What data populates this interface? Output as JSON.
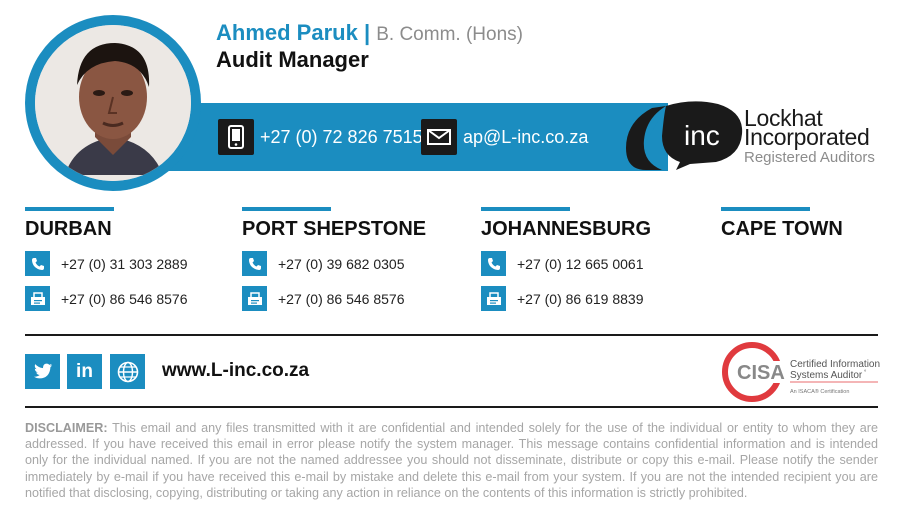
{
  "person": {
    "name": "Ahmed Paruk",
    "separator": "|",
    "qualification": "B. Comm. (Hons)",
    "role": "Audit Manager"
  },
  "contact": {
    "phone": "+27 (0) 72 826 7515",
    "email": "ap@L-inc.co.za",
    "phone_icon": "mobile-phone-icon",
    "email_icon": "envelope-icon"
  },
  "logo": {
    "mark": "inc",
    "line1": "Lockhat",
    "line2": "Incorporated",
    "line3": "Registered Auditors"
  },
  "offices": [
    {
      "city": "DURBAN",
      "phone": "+27 (0) 31 303 2889",
      "fax": "+27 (0) 86 546 8576"
    },
    {
      "city": "PORT SHEPSTONE",
      "phone": "+27 (0) 39 682 0305",
      "fax": "+27 (0) 86 546 8576"
    },
    {
      "city": "JOHANNESBURG",
      "phone": "+27 (0) 12 665 0061",
      "fax": "+27 (0) 86 619 8839"
    },
    {
      "city": "CAPE TOWN"
    }
  ],
  "social": {
    "twitter": "twitter-icon",
    "linkedin_label": "in",
    "web_icon": "globe-icon",
    "website": "www.L-inc.co.za"
  },
  "cisa": {
    "badge": "CISA",
    "line1": "Certified Information",
    "line2": "Systems Auditor",
    "mark": "°",
    "sub": "An ISACA® Certification"
  },
  "disclaimer": {
    "label": "DISCLAIMER:",
    "text": " This email and any files transmitted with it are confidential and intended solely for the use of the individual or entity to whom they are addressed. If you have received this email in error please notify the system manager. This message contains confidential information and is intended only for the individual named. If you are not the named addressee you should not disseminate, distribute or copy this e-mail. Please notify the sender immediately by e-mail if you have received this e-mail by mistake and delete this e-mail from your system. If you are not the intended recipient you are notified that disclosing, copying, distributing or taking any action in reliance on the contents of this information is strictly prohibited."
  },
  "colors": {
    "accent": "#1b8dc0",
    "dark": "#1a1a1a",
    "cisa_red": "#e03a3e"
  }
}
